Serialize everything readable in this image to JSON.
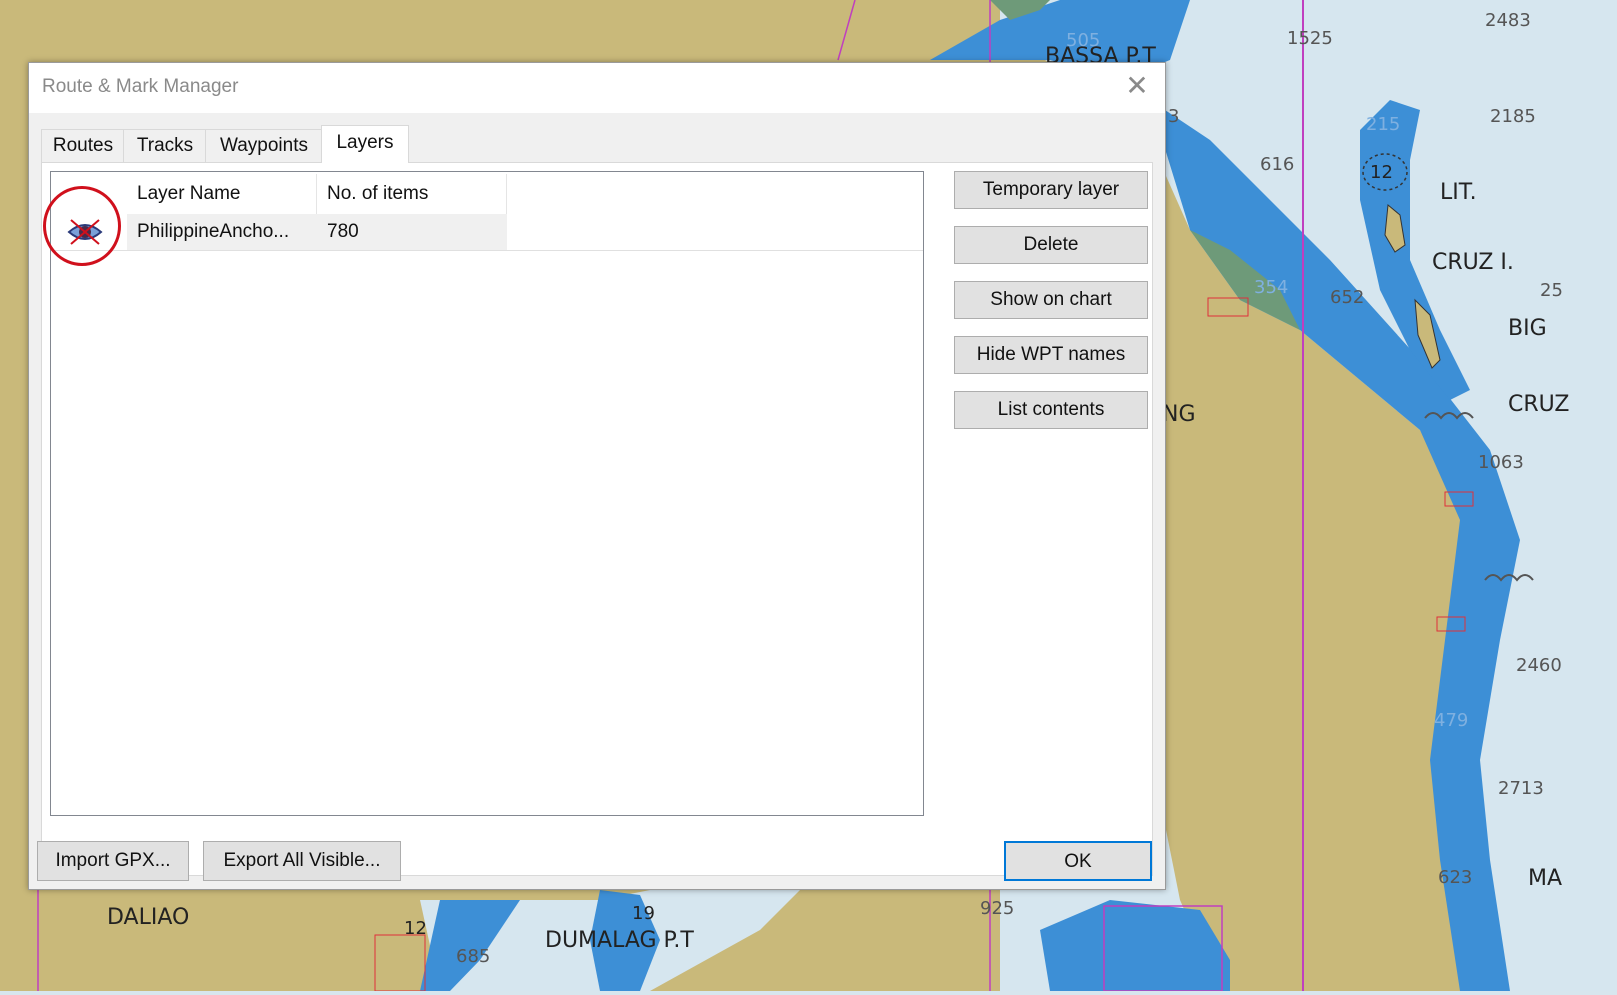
{
  "chart": {
    "labels": {
      "bassa": "BASSA P.T",
      "lit": "LIT.",
      "cruz_i": "CRUZ I.",
      "big": "BIG",
      "cruz": "CRUZ",
      "ng": "NG",
      "daliao": "DALIAO",
      "dumalag": "DUMALAG P.T",
      "ma": "MA"
    },
    "depths": {
      "d2483": "2483",
      "d1525": "1525",
      "d505": "505",
      "d2185": "2185",
      "d215": "215",
      "d616": "616",
      "d12a": "12",
      "d3": "3",
      "d354": "354",
      "d652": "652",
      "d25": "25",
      "d1063": "1063",
      "d2460": "2460",
      "d479": "479",
      "d2713": "2713",
      "d623": "623",
      "d925": "925",
      "d19": "19",
      "d12b": "12",
      "d685": "685"
    },
    "colors": {
      "land": "#c9b97a",
      "shallow": "#3d8fd6",
      "deep": "#d6e6ef",
      "limit": "#c03fbf",
      "green": "#6e9a79"
    }
  },
  "dialog": {
    "title": "Route & Mark Manager",
    "close_glyph": "✕",
    "tabs": [
      {
        "label": "Routes"
      },
      {
        "label": "Tracks"
      },
      {
        "label": "Waypoints"
      },
      {
        "label": "Layers",
        "active": true
      }
    ],
    "columns": {
      "layer_name": "Layer Name",
      "item_count": "No. of items"
    },
    "rows": [
      {
        "visible": false,
        "visibility_icon": "eye-crossed-icon",
        "layer_name": "PhilippineAncho...",
        "item_count": "780"
      }
    ],
    "side_buttons": {
      "temporary_layer": "Temporary layer",
      "delete": "Delete",
      "show_on_chart": "Show on chart",
      "hide_wpt_names": "Hide WPT names",
      "list_contents": "List contents"
    },
    "bottom_buttons": {
      "import_gpx": "Import GPX...",
      "export_all_visible": "Export All Visible...",
      "ok": "OK"
    },
    "highlight_color": "#d0101c",
    "accent_color": "#0078d7"
  }
}
